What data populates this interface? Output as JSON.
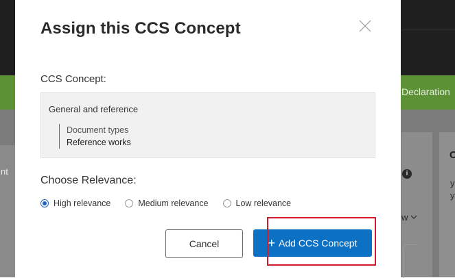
{
  "background": {
    "banner_text": "Declaration",
    "left_text": "nt",
    "heading_letter": "C",
    "body_letters": [
      "y",
      "y"
    ],
    "dropdown_text": "w",
    "info_glyph": "i"
  },
  "modal": {
    "title": "Assign this CCS Concept",
    "close_icon": "close-icon",
    "concept_label": "CCS Concept:",
    "concept": {
      "root": "General and reference",
      "children": [
        "Document types",
        "Reference works"
      ]
    },
    "relevance_label": "Choose Relevance:",
    "relevance_options": [
      {
        "label": "High relevance",
        "checked": true
      },
      {
        "label": "Medium relevance",
        "checked": false
      },
      {
        "label": "Low relevance",
        "checked": false
      }
    ],
    "cancel_label": "Cancel",
    "add_label": "Add CCS Concept",
    "add_icon": "+"
  },
  "colors": {
    "primary": "#0c71c3",
    "radio_checked": "#1f62c6",
    "highlight": "#d11a2a",
    "banner_green": "#5c9136"
  }
}
